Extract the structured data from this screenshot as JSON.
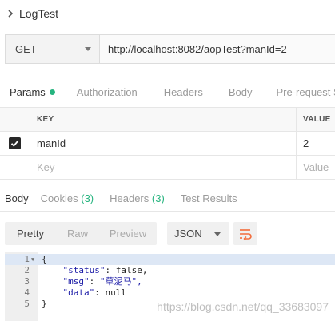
{
  "request": {
    "title": "LogTest",
    "method": "GET",
    "url": "http://localhost:8082/aopTest?manId=2"
  },
  "request_tabs": [
    {
      "label": "Params"
    },
    {
      "label": "Authorization"
    },
    {
      "label": "Headers"
    },
    {
      "label": "Body"
    },
    {
      "label": "Pre-request Sc"
    }
  ],
  "params": {
    "columns": {
      "key": "KEY",
      "value": "VALUE"
    },
    "rows": [
      {
        "key": "manId",
        "value": "2"
      }
    ],
    "placeholder": {
      "key": "Key",
      "value": "Value"
    }
  },
  "response_tabs": [
    {
      "label": "Body"
    },
    {
      "label": "Cookies",
      "count": "(3)"
    },
    {
      "label": "Headers",
      "count": "(3)"
    },
    {
      "label": "Test Results"
    }
  ],
  "view_modes": [
    {
      "label": "Pretty"
    },
    {
      "label": "Raw"
    },
    {
      "label": "Preview"
    }
  ],
  "format": {
    "selected": "JSON"
  },
  "editor": {
    "lines": [
      {
        "num": "1",
        "open": "{"
      },
      {
        "num": "2",
        "key": "\"status\"",
        "value": "false,"
      },
      {
        "num": "3",
        "key": "\"msg\"",
        "value": "\"草泥马\","
      },
      {
        "num": "4",
        "key": "\"data\"",
        "value": "null"
      },
      {
        "num": "5",
        "close": "}"
      }
    ]
  },
  "watermark": "https://blog.csdn.net/qq_33683097",
  "colors": {
    "accent": "#f26b3a",
    "success": "#26b47f"
  }
}
